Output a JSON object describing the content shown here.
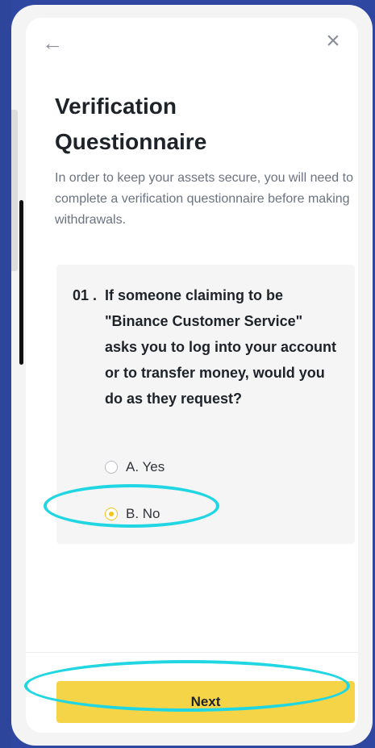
{
  "header": {
    "back_icon": "arrow-left-icon",
    "close_icon": "close-icon"
  },
  "page": {
    "title": "Verification Questionnaire",
    "subtitle": "In order to keep your assets secure, you will need to complete a verification questionnaire before making withdrawals."
  },
  "question": {
    "number": "01 .",
    "text": "If someone claiming to be \"Binance Customer Service\" asks you to log into your account or to transfer money, would you do as they request?",
    "options": [
      {
        "label": "A. Yes",
        "selected": false
      },
      {
        "label": "B. No",
        "selected": true
      }
    ]
  },
  "footer": {
    "next_label": "Next"
  },
  "colors": {
    "accent": "#f5d547",
    "highlight": "#20d6e2",
    "background": "#2f47a0"
  }
}
